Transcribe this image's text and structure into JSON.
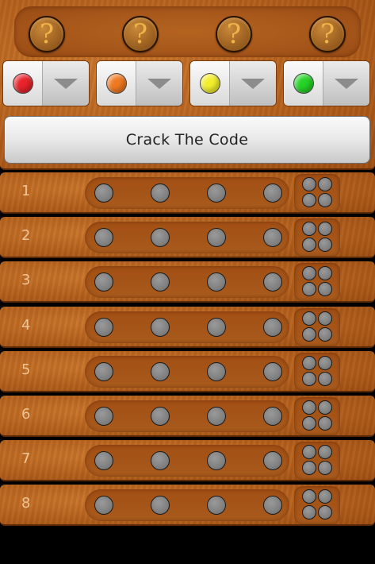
{
  "secret": {
    "pegs": [
      "?",
      "?",
      "?",
      "?"
    ]
  },
  "selectors": [
    {
      "color_name": "red",
      "color": "#e8232a"
    },
    {
      "color_name": "orange",
      "color": "#f07a22"
    },
    {
      "color_name": "yellow",
      "color": "#f2ee2c"
    },
    {
      "color_name": "green",
      "color": "#25d426"
    }
  ],
  "crack_button_label": "Crack The Code",
  "rows": [
    {
      "number": "1"
    },
    {
      "number": "2"
    },
    {
      "number": "3"
    },
    {
      "number": "4"
    },
    {
      "number": "5"
    },
    {
      "number": "6"
    },
    {
      "number": "7"
    },
    {
      "number": "8"
    }
  ],
  "icons": {
    "dropdown": "chevron-down-icon",
    "unknown_peg": "question-mark-icon"
  },
  "colors": {
    "wood": "#b25f1c",
    "empty_hole": "#808080",
    "background": "#000000"
  }
}
